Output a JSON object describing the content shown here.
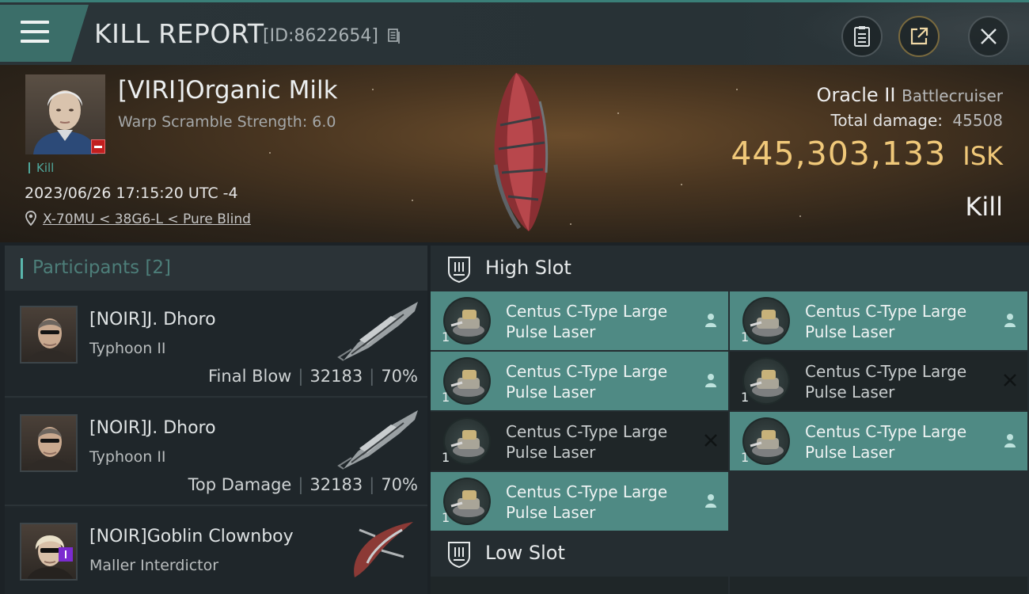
{
  "header": {
    "title": "KILL REPORT",
    "id_label": "[ID:8622654]"
  },
  "victim": {
    "name": "[VIRI]Organic Milk",
    "warp_scramble": "Warp Scramble Strength: 6.0",
    "kill_tag": "Kill",
    "timestamp": "2023/06/26 17:15:20 UTC -4",
    "location": "X-70MU < 38G6-L < Pure Blind",
    "ship_name": "Oracle II",
    "ship_class": "Battlecruiser",
    "total_damage_label": "Total damage:",
    "total_damage": "45508",
    "isk_value": "445,303,133",
    "isk_unit": "ISK",
    "result": "Kill"
  },
  "participants": {
    "title": "Participants [2]",
    "items": [
      {
        "name": "[NOIR]J. Dhoro",
        "ship": "Typhoon II",
        "role": "Final Blow",
        "damage": "32183",
        "percent": "70%"
      },
      {
        "name": "[NOIR]J. Dhoro",
        "ship": "Typhoon II",
        "role": "Top Damage",
        "damage": "32183",
        "percent": "70%"
      },
      {
        "name": "[NOIR]Goblin Clownboy",
        "ship": "Maller Interdictor"
      }
    ]
  },
  "fittings": {
    "high_slot_label": "High Slot",
    "low_slot_label": "Low Slot",
    "high_slot_modules": [
      {
        "line1": "Centus C-Type Large",
        "line2": "Pulse Laser",
        "qty": "1",
        "status": "dropped"
      },
      {
        "line1": "Centus C-Type Large",
        "line2": "Pulse Laser",
        "qty": "1",
        "status": "dropped"
      },
      {
        "line1": "Centus C-Type Large",
        "line2": "Pulse Laser",
        "qty": "1",
        "status": "dropped"
      },
      {
        "line1": "Centus C-Type Large",
        "line2": "Pulse Laser",
        "qty": "1",
        "status": "destroyed"
      },
      {
        "line1": "Centus C-Type Large",
        "line2": "Pulse Laser",
        "qty": "1",
        "status": "destroyed"
      },
      {
        "line1": "Centus C-Type Large",
        "line2": "Pulse Laser",
        "qty": "1",
        "status": "dropped"
      },
      {
        "line1": "Centus C-Type Large",
        "line2": "Pulse Laser",
        "qty": "1",
        "status": "dropped"
      }
    ]
  },
  "colors": {
    "accent": "#5ab7ad",
    "isk": "#f0c879",
    "module_dropped": "#4f8a84",
    "module_destroyed": "#1f2628"
  }
}
